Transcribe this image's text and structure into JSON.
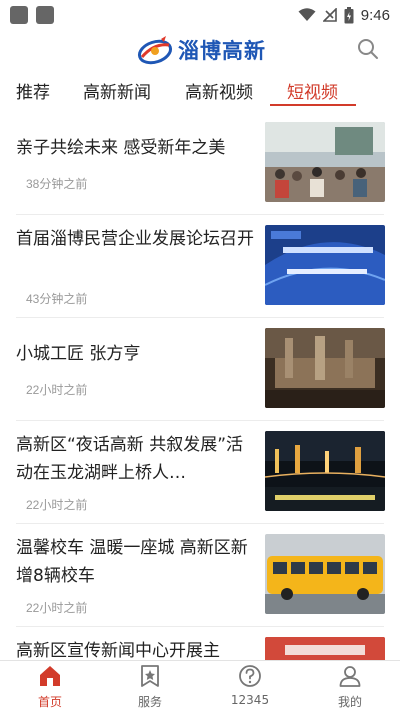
{
  "status": {
    "time": "9:46"
  },
  "header": {
    "logo_text": "淄博高新"
  },
  "tabs": [
    {
      "label": "推荐"
    },
    {
      "label": "高新新闻"
    },
    {
      "label": "高新视频"
    },
    {
      "label": "短视频"
    }
  ],
  "feed": [
    {
      "title": "亲子共绘未来 感受新年之美",
      "time": "38分钟之前"
    },
    {
      "title": "首届淄博民营企业发展论坛召开",
      "time": "43分钟之前"
    },
    {
      "title": "小城工匠 张方亨",
      "time": "22小时之前"
    },
    {
      "title": "高新区“夜话高新 共叙发展”活动在玉龙湖畔上桥人…",
      "time": "22小时之前"
    },
    {
      "title": "温馨校车 温暖一座城 高新区新增8辆校车",
      "time": "22小时之前"
    },
    {
      "title": "高新区宣传新闻中心开展主",
      "time": ""
    }
  ],
  "bottom_nav": [
    {
      "label": "首页"
    },
    {
      "label": "服务"
    },
    {
      "label": "12345"
    },
    {
      "label": "我的"
    }
  ],
  "colors": {
    "accent": "#d23b2a",
    "brand": "#1f57b5"
  }
}
